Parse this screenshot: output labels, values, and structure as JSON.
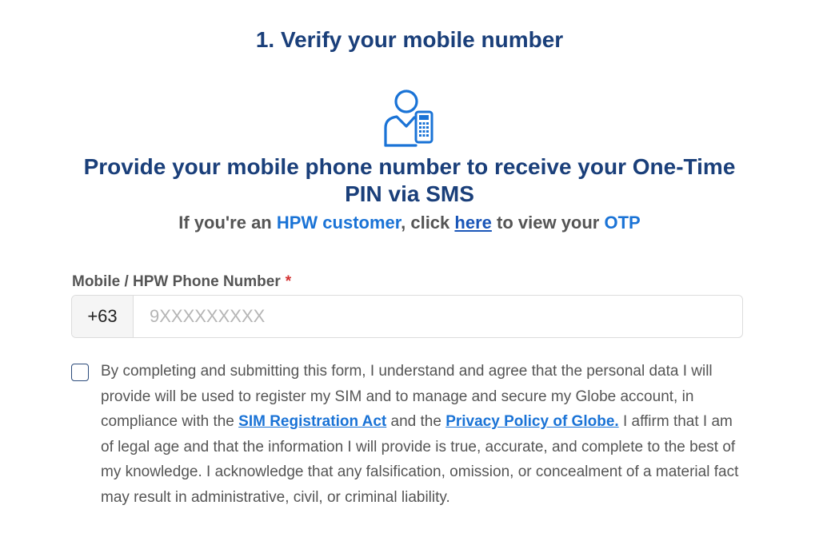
{
  "step_title": "1. Verify your mobile number",
  "icon": "user-mobile-icon",
  "headline": "Provide your mobile phone number to receive your One-Time PIN via SMS",
  "subline": {
    "prefix": "If you're an ",
    "customer": "HPW customer",
    "middle": ", click ",
    "link": "here",
    "middle2": " to view your ",
    "otp": "OTP"
  },
  "phone_field": {
    "label": "Mobile / HPW Phone Number",
    "required_mark": "*",
    "country_code": "+63",
    "value": "",
    "placeholder": "9XXXXXXXXX"
  },
  "consent": {
    "checked": false,
    "text_1": "By completing and submitting this form, I understand and agree that the personal data I will provide will be used to register my SIM and to manage and secure my Globe account, in compliance with the ",
    "link_1": "SIM Registration Act",
    "text_2": " and the ",
    "link_2": "Privacy Policy of Globe.",
    "text_3": " I affirm that I am of legal age and that the information I will provide is true, accurate, and complete to the best of my knowledge. I acknowledge that any falsification, omission, or concealment of a material fact may result in administrative, civil, or criminal liability."
  },
  "colors": {
    "title_navy": "#1a3f7a",
    "accent_blue": "#1a73d6",
    "required_red": "#d32f2f",
    "body_gray": "#555555"
  }
}
